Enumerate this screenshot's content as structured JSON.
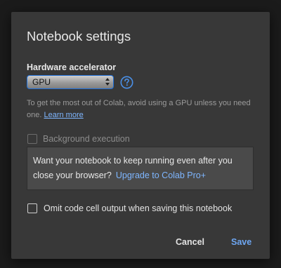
{
  "dialog": {
    "title": "Notebook settings",
    "hardware": {
      "label": "Hardware accelerator",
      "selected": "GPU",
      "hint_text": "To get the most out of Colab, avoid using a GPU unless you need one.",
      "learn_more": "Learn more"
    },
    "background_execution": {
      "label": "Background execution",
      "checked": false,
      "disabled": true,
      "message": "Want your notebook to keep running even after you close your browser?",
      "upgrade_link": "Upgrade to Colab Pro+"
    },
    "omit_output": {
      "label": "Omit code cell output when saving this notebook",
      "checked": false
    },
    "buttons": {
      "cancel": "Cancel",
      "save": "Save"
    }
  },
  "colors": {
    "accent": "#1e6fd9",
    "link": "#7eb6ff",
    "save": "#6ea7f3",
    "dialog_bg": "#383838"
  }
}
